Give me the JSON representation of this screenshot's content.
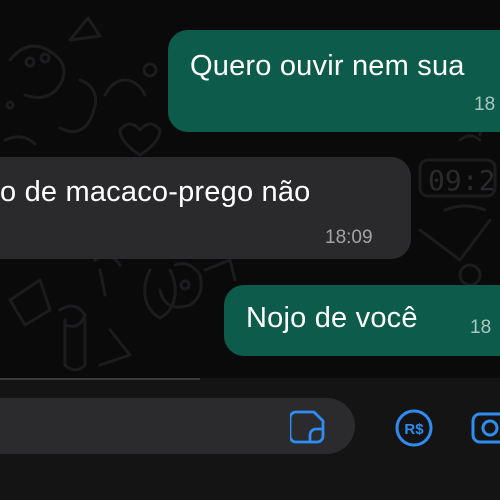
{
  "chat": {
    "messages": [
      {
        "direction": "outgoing",
        "text": "Quero ouvir nem sua",
        "time": "18"
      },
      {
        "direction": "incoming",
        "text": "o de macaco-prego não",
        "time": "18:09"
      },
      {
        "direction": "outgoing",
        "text": "Nojo de você",
        "time": "18"
      }
    ]
  },
  "composer": {
    "input_value": "",
    "icons": [
      "sticker-icon",
      "pix-payment-icon",
      "camera-icon"
    ]
  },
  "colors": {
    "background": "#0a0a0b",
    "outgoing_bubble": "#0d5c4b",
    "incoming_bubble": "#2a2a2c",
    "accent_icon": "#2f8cf0"
  }
}
